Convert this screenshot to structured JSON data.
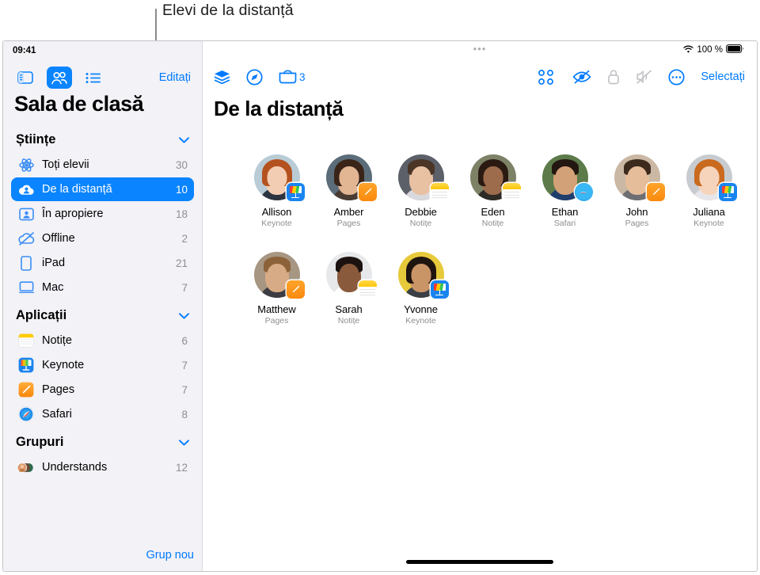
{
  "callout": {
    "label": "Elevi de la distanță"
  },
  "status_bar": {
    "time": "09:41",
    "battery_percent": "100 %",
    "wifi_icon": "wifi-icon",
    "battery_icon": "battery-icon",
    "dots_icon": "multitasking-dots-icon"
  },
  "sidebar": {
    "toolbar": {
      "sidebar_toggle_icon": "sidebar-toggle-icon",
      "people_icon": "people-icon",
      "list_icon": "list-icon",
      "edit_label": "Editați"
    },
    "title": "Sala de clasă",
    "sections": [
      {
        "title": "Științe",
        "chevron": "⌄",
        "items": [
          {
            "icon": "atom-icon",
            "label": "Toți elevii",
            "count": "30",
            "selected": false
          },
          {
            "icon": "cloud-person-icon",
            "label": "De la distanță",
            "count": "10",
            "selected": true
          },
          {
            "icon": "person-frame-icon",
            "label": "În apropiere",
            "count": "18",
            "selected": false
          },
          {
            "icon": "cloud-slash-icon",
            "label": "Offline",
            "count": "2",
            "selected": false
          },
          {
            "icon": "ipad-icon",
            "label": "iPad",
            "count": "21",
            "selected": false
          },
          {
            "icon": "mac-icon",
            "label": "Mac",
            "count": "7",
            "selected": false
          }
        ]
      },
      {
        "title": "Aplicații",
        "chevron": "⌄",
        "items": [
          {
            "icon": "notes-app-icon",
            "label": "Notițe",
            "count": "6",
            "selected": false
          },
          {
            "icon": "keynote-app-icon",
            "label": "Keynote",
            "count": "7",
            "selected": false
          },
          {
            "icon": "pages-app-icon",
            "label": "Pages",
            "count": "7",
            "selected": false
          },
          {
            "icon": "safari-app-icon",
            "label": "Safari",
            "count": "8",
            "selected": false
          }
        ]
      },
      {
        "title": "Grupuri",
        "chevron": "⌄",
        "items": [
          {
            "icon": "group-avatars-icon",
            "label": "Understands",
            "count": "12",
            "selected": false
          }
        ]
      }
    ],
    "new_group_label": "Grup nou"
  },
  "main": {
    "toolbar_left": [
      {
        "icon": "layers-icon",
        "label": ""
      },
      {
        "icon": "navigate-compass-icon",
        "label": ""
      },
      {
        "icon": "inbox-tray-icon",
        "label": "3"
      }
    ],
    "toolbar_right": [
      {
        "icon": "grid-apps-icon",
        "dim": false
      },
      {
        "icon": "eye-slash-icon",
        "dim": false
      },
      {
        "icon": "lock-icon",
        "dim": true
      },
      {
        "icon": "speaker-mute-icon",
        "dim": true
      },
      {
        "icon": "more-circle-icon",
        "dim": false
      }
    ],
    "select_label": "Selectați",
    "title": "De la distanță",
    "students": [
      {
        "name": "Allison",
        "app": "Keynote",
        "badge": "keynote",
        "skin": "#f3cdb3",
        "hair": "#b4521f",
        "bg": "#b9ccd6",
        "shirt": "#2c3440",
        "long": true
      },
      {
        "name": "Amber",
        "app": "Pages",
        "badge": "pages",
        "skin": "#e2b593",
        "hair": "#3a2418",
        "bg": "#5b6d78",
        "shirt": "#4a3b33",
        "long": true
      },
      {
        "name": "Debbie",
        "app": "Notițe",
        "badge": "notes",
        "skin": "#e8c0a2",
        "hair": "#4b3526",
        "bg": "#5b6069",
        "shirt": "#d9d9dd",
        "long": false
      },
      {
        "name": "Eden",
        "app": "Notițe",
        "badge": "notes",
        "skin": "#9d6c4c",
        "hair": "#2a1a12",
        "bg": "#7d8267",
        "shirt": "#2e2a26",
        "long": true
      },
      {
        "name": "Ethan",
        "app": "Safari",
        "badge": "safari",
        "skin": "#d3a177",
        "hair": "#241610",
        "bg": "#5c7a4a",
        "shirt": "#1f3e6e",
        "long": false
      },
      {
        "name": "John",
        "app": "Pages",
        "badge": "pages",
        "skin": "#e5bd9b",
        "hair": "#3c2a1c",
        "bg": "#cbb8a4",
        "shirt": "#6e6e73",
        "long": false
      },
      {
        "name": "Juliana",
        "app": "Keynote",
        "badge": "keynote",
        "skin": "#f6d3bb",
        "hair": "#c96a1e",
        "bg": "#c8ccd1",
        "shirt": "#e6e6ea",
        "long": true
      },
      {
        "name": "Matthew",
        "app": "Pages",
        "badge": "pages",
        "skin": "#d7ab85",
        "hair": "#8c6239",
        "bg": "#a79682",
        "shirt": "#3c3c42",
        "long": false
      },
      {
        "name": "Sarah",
        "app": "Notițe",
        "badge": "notes",
        "skin": "#8a5a3c",
        "hair": "#1c1310",
        "bg": "#e6e8ea",
        "shirt": "#ffffff",
        "long": false
      },
      {
        "name": "Yvonne",
        "app": "Keynote",
        "badge": "keynote",
        "skin": "#c99466",
        "hair": "#1e1410",
        "bg": "#e7c93c",
        "shirt": "#3a3f46",
        "long": true
      }
    ]
  },
  "colors": {
    "accent": "#007aff",
    "selected_bg": "#0a84ff",
    "sidebar_bg": "#f2f2f7",
    "muted": "#8e8e93"
  }
}
